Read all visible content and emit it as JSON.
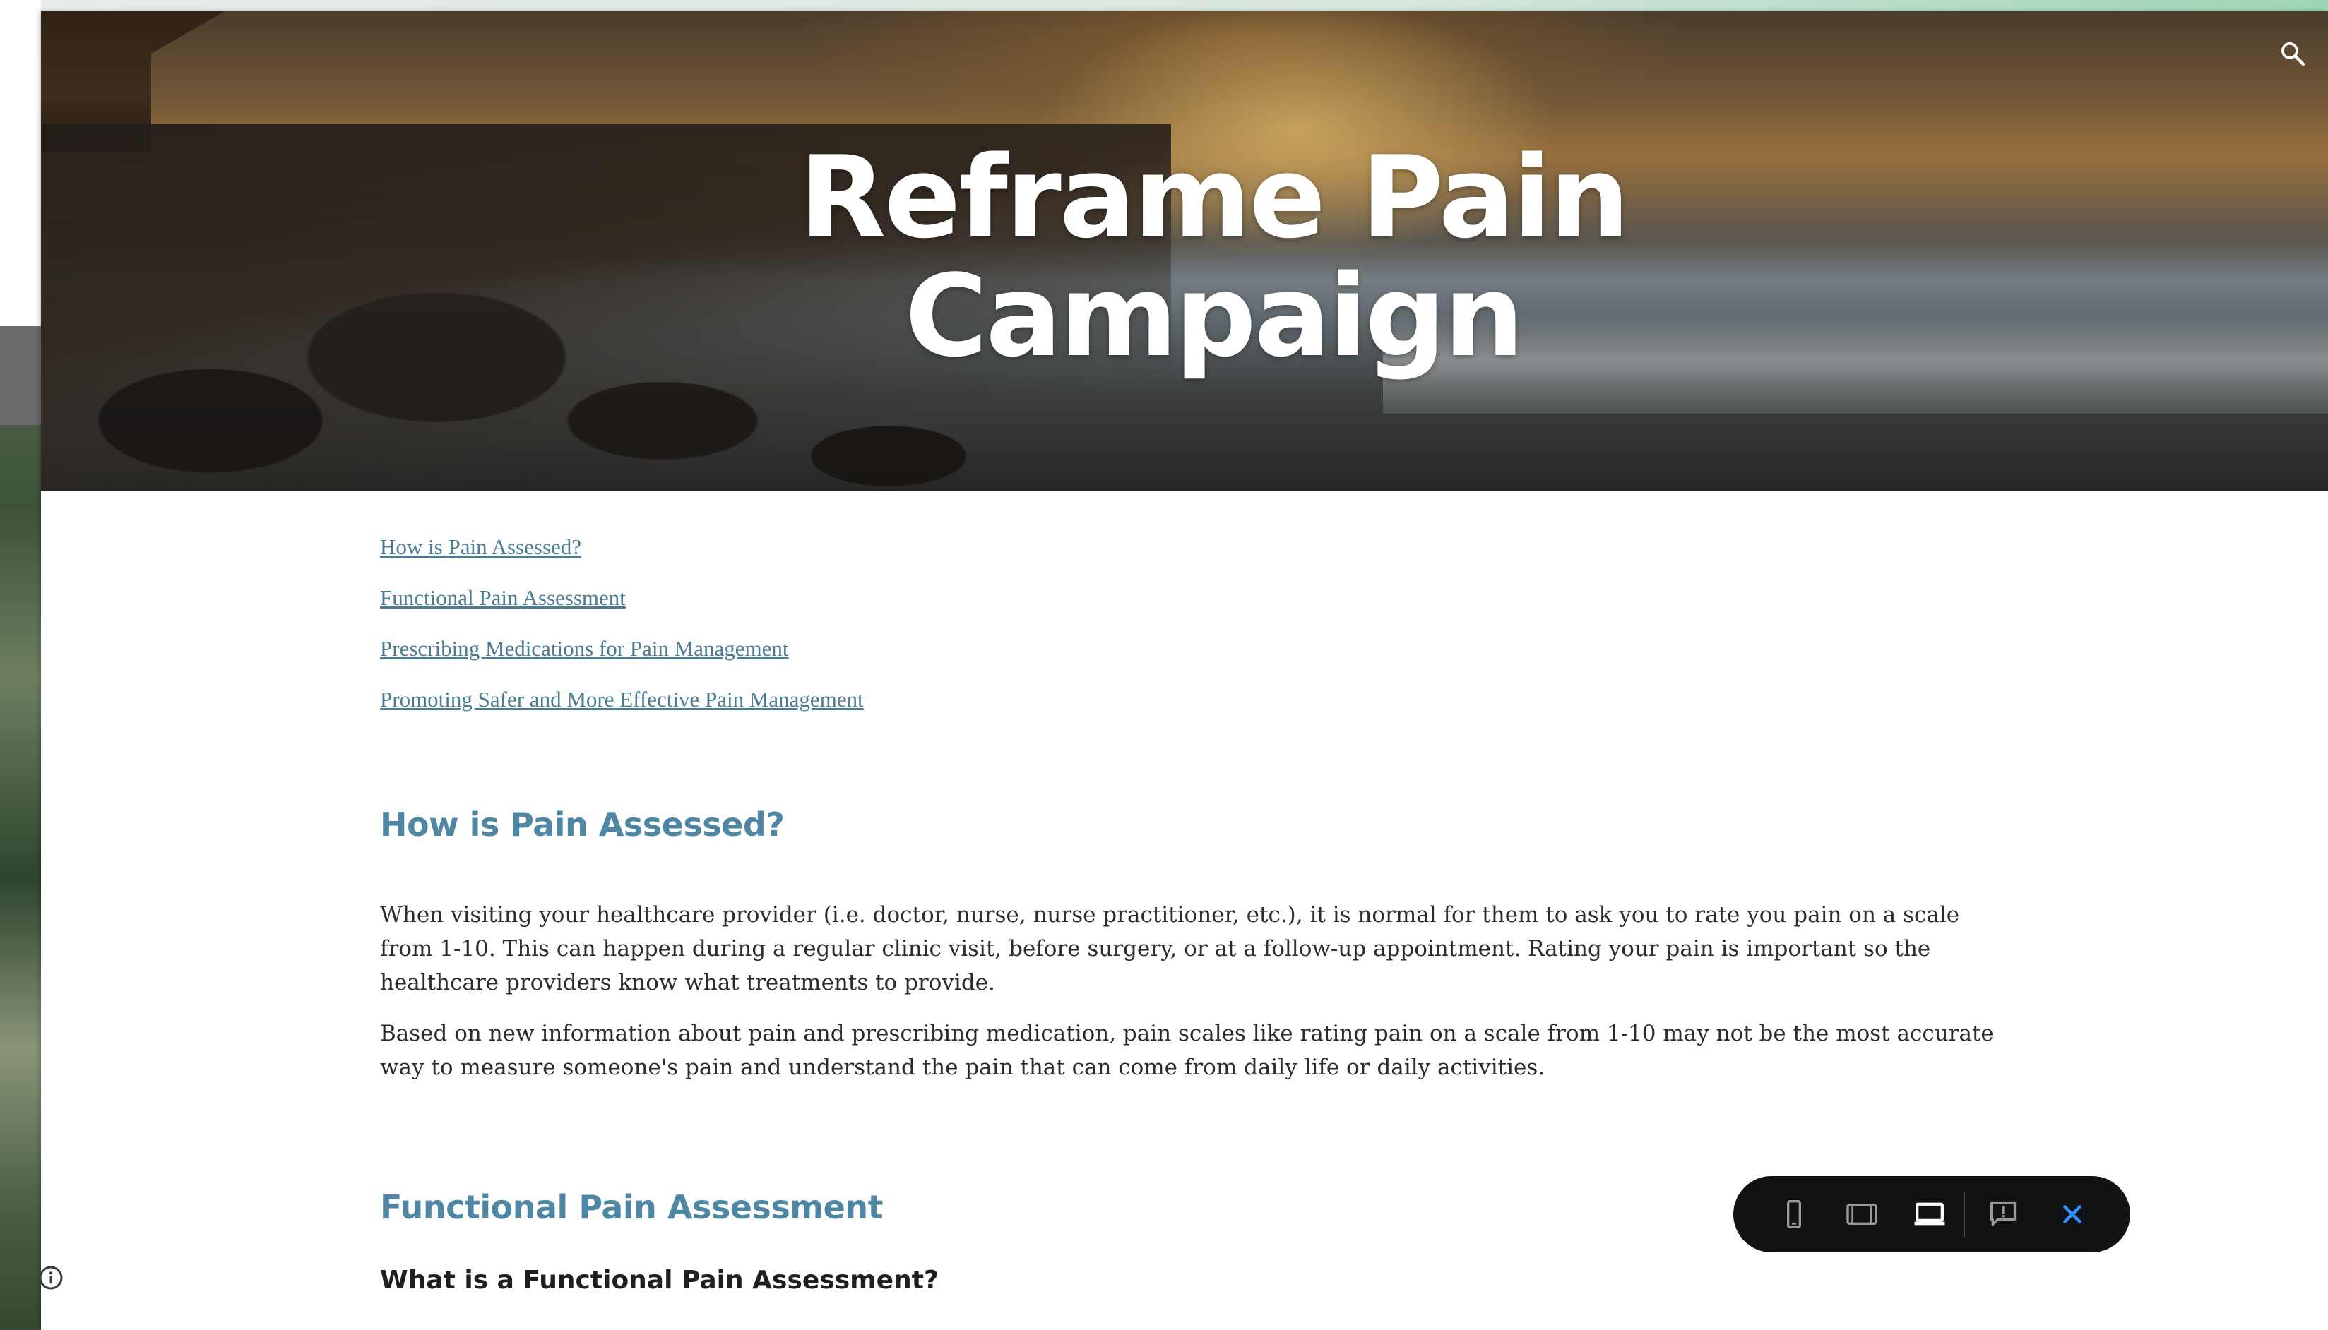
{
  "hero": {
    "title": "Reframe Pain Campaign"
  },
  "toc": [
    {
      "label": "How is Pain Assessed?"
    },
    {
      "label": "Functional Pain Assessment"
    },
    {
      "label": "Prescribing Medications for Pain Management"
    },
    {
      "label": "Promoting Safer and More Effective Pain Management"
    }
  ],
  "sections": [
    {
      "heading": "How is Pain Assessed?",
      "paragraphs": [
        "When visiting your healthcare provider (i.e. doctor, nurse, nurse practitioner, etc.), it is normal for them to ask you to rate you pain on a scale from 1-10. This can happen during a regular clinic visit, before surgery, or at a follow-up appointment. Rating your pain is important so the healthcare providers know what treatments to provide.",
        "Based on new information about pain and prescribing medication, pain scales like rating pain on a scale from 1-10 may not be the most accurate way to measure someone's pain and understand the pain that can come from daily life or daily activities."
      ]
    },
    {
      "heading": "Functional Pain Assessment",
      "subheading": "What is a Functional Pain Assessment?"
    }
  ],
  "icons": {
    "search": "search-icon",
    "info": "info-icon",
    "phone": "phone-icon",
    "tablet": "tablet-icon",
    "laptop": "laptop-icon",
    "feedback": "feedback-icon",
    "close": "close-icon"
  },
  "colors": {
    "link": "#4a7c93",
    "heading": "#4e87a3",
    "body_text": "#2b2b2b",
    "preview_bar": "#111214",
    "close_accent": "#2f8fff",
    "active_icon": "#ffffff",
    "inactive_icon": "#9a9a9a"
  },
  "preview_toolbar": {
    "active_device": "laptop"
  }
}
